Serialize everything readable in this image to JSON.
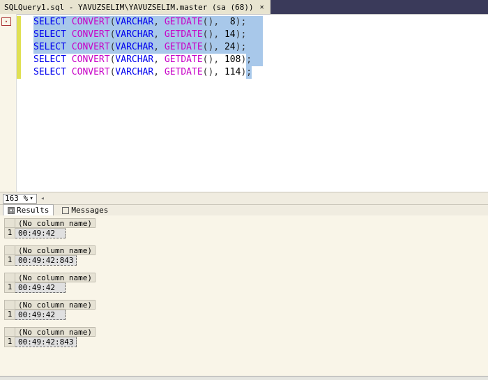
{
  "tab": {
    "title": "SQLQuery1.sql - YAVUZSELIM\\YAVUZSELIM.master (sa (68))"
  },
  "code": {
    "kw": {
      "select": "SELECT",
      "convert": "CONVERT",
      "getdate": "GETDATE"
    },
    "type": "VARCHAR",
    "styleArgs": [
      "8",
      "14",
      "24",
      "108",
      "114"
    ]
  },
  "zoom": {
    "value": "163 %"
  },
  "resultTabs": {
    "results": "Results",
    "messages": "Messages"
  },
  "results": [
    {
      "header": "(No column name)",
      "rownum": "1",
      "value": "00:49:42"
    },
    {
      "header": "(No column name)",
      "rownum": "1",
      "value": "00:49:42:843"
    },
    {
      "header": "(No column name)",
      "rownum": "1",
      "value": "00:49:42"
    },
    {
      "header": "(No column name)",
      "rownum": "1",
      "value": "00:49:42"
    },
    {
      "header": "(No column name)",
      "rownum": "1",
      "value": "00:49:42:843"
    }
  ]
}
